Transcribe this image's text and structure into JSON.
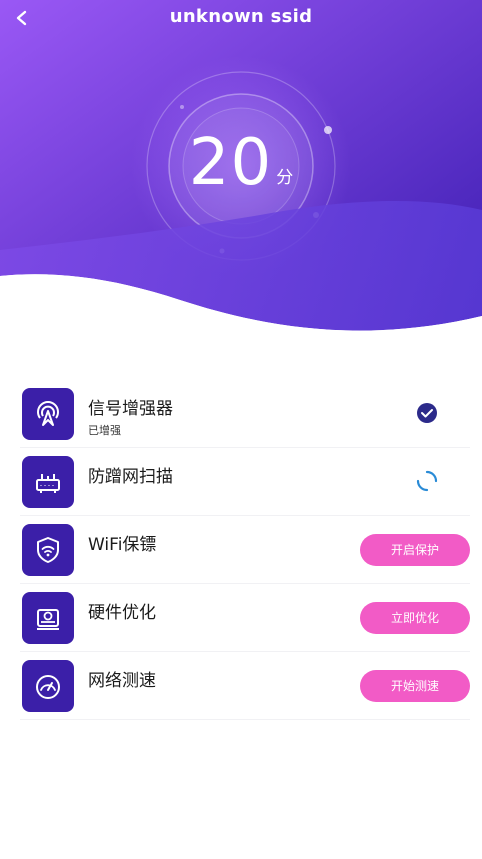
{
  "header": {
    "title": "unknown ssid"
  },
  "score": {
    "value": "20",
    "unit": "分"
  },
  "items": [
    {
      "title": "信号增强器",
      "subtitle": "已增强",
      "state": "done"
    },
    {
      "title": "防蹭网扫描",
      "state": "scanning"
    },
    {
      "title": "WiFi保镖",
      "button": "开启保护"
    },
    {
      "title": "硬件优化",
      "button": "立即优化"
    },
    {
      "title": "网络测速",
      "button": "开始测速"
    }
  ],
  "colors": {
    "gradient_start": "#8a4df2",
    "gradient_end": "#3b1fb0",
    "icon_bg": "#3b1fa8",
    "button_pink": "#f25bc6",
    "check_blue": "#2c2a8a",
    "spinner_blue": "#2a8bd6"
  },
  "icons": [
    "back-arrow-icon",
    "signal-tower-icon",
    "router-icon",
    "shield-wifi-icon",
    "hardware-disk-icon",
    "speedometer-icon",
    "check-circle-icon",
    "spinner-icon"
  ]
}
